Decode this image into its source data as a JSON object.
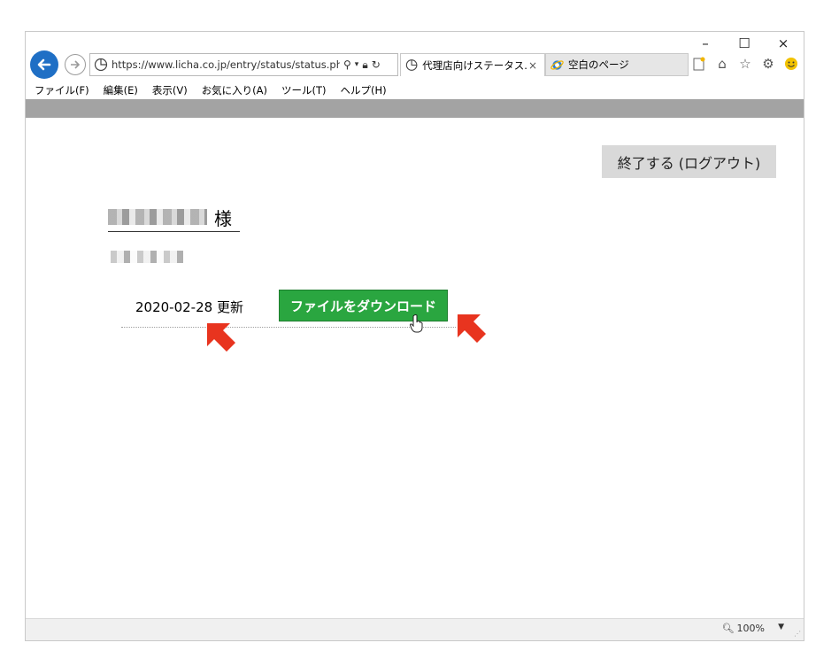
{
  "browser": {
    "window_controls": {
      "minimize": "–",
      "maximize": "☐",
      "close": "×"
    },
    "address": "https://www.licha.co.jp/entry/status/status.php?l",
    "tabs": [
      {
        "label": "代理店向けステータス...",
        "close": "×"
      },
      {
        "label": "空白のページ"
      }
    ],
    "menu": [
      "ファイル(F)",
      "編集(E)",
      "表示(V)",
      "お気に入り(A)",
      "ツール(T)",
      "ヘルプ(H)"
    ],
    "zoom": "100%"
  },
  "page": {
    "logout_button": "終了する (ログアウト)",
    "user_suffix": "様",
    "update_text": "2020-02-28 更新",
    "download_button": "ファイルをダウンロード"
  },
  "annotations": {
    "arrow_color": "#e8341f"
  },
  "colors": {
    "download_green": "#2aa640",
    "back_blue": "#1f6fc5"
  }
}
